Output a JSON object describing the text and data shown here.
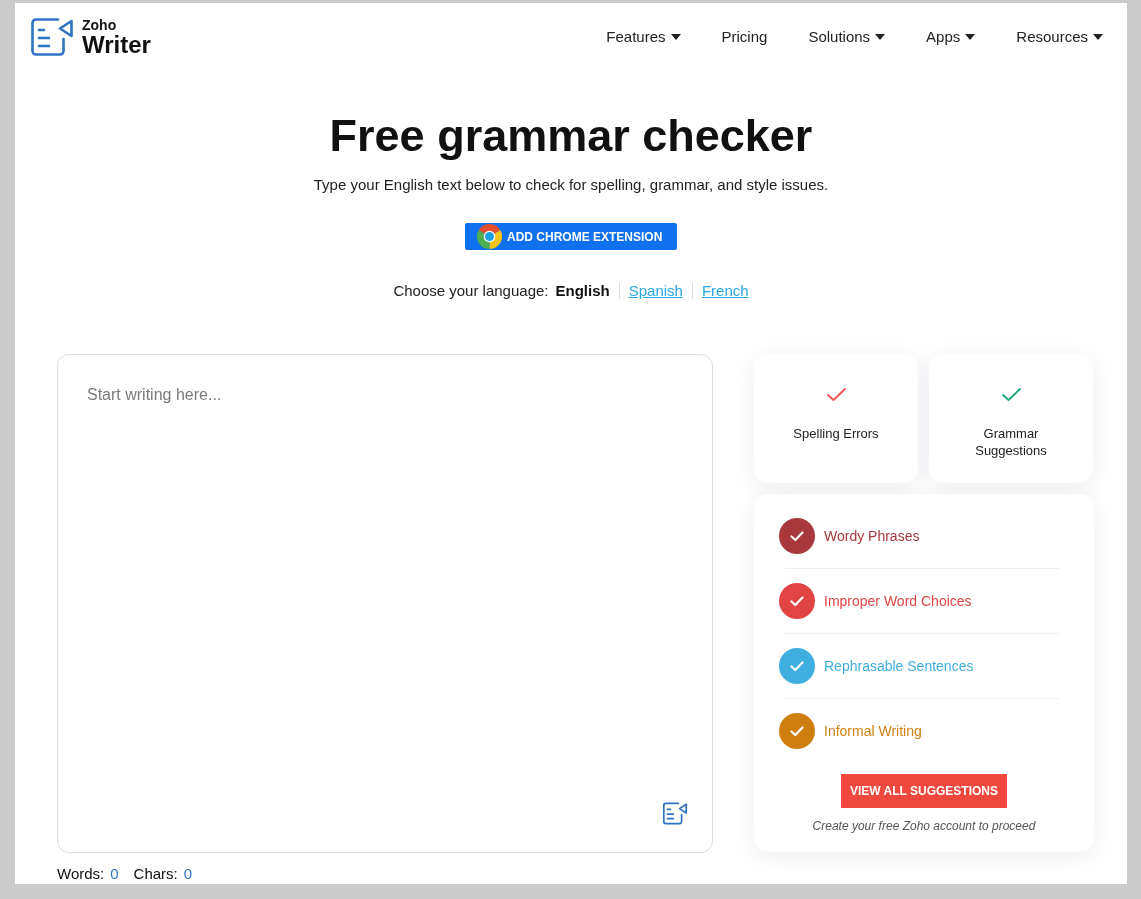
{
  "header": {
    "logo": {
      "brand": "Zoho",
      "product": "Writer"
    },
    "nav": [
      {
        "label": "Features",
        "has_menu": true
      },
      {
        "label": "Pricing",
        "has_menu": false
      },
      {
        "label": "Solutions",
        "has_menu": true
      },
      {
        "label": "Apps",
        "has_menu": true
      },
      {
        "label": "Resources",
        "has_menu": true
      }
    ]
  },
  "hero": {
    "title": "Free grammar checker",
    "subtitle": "Type your English text below to check for spelling, grammar, and style issues.",
    "button": "ADD CHROME EXTENSION"
  },
  "language": {
    "label": "Choose your language:",
    "options": [
      {
        "label": "English",
        "selected": true
      },
      {
        "label": "Spanish",
        "selected": false
      },
      {
        "label": "French",
        "selected": false
      }
    ]
  },
  "editor": {
    "placeholder": "Start writing here..."
  },
  "summary_cards": [
    {
      "label": "Spelling Errors",
      "color": "#f0524f"
    },
    {
      "label": "Grammar Suggestions",
      "color": "#1aa37a"
    }
  ],
  "categories": [
    {
      "label": "Wordy Phrases",
      "color": "#a8383b"
    },
    {
      "label": "Improper Word Choices",
      "color": "#e24444"
    },
    {
      "label": "Rephrasable Sentences",
      "color": "#3eaedf"
    },
    {
      "label": "Informal Writing",
      "color": "#cf7f10"
    }
  ],
  "suggestions_button": "VIEW ALL SUGGESTIONS",
  "signup_note": "Create your free Zoho account to proceed",
  "counters": [
    {
      "label": "Words:",
      "value": "0"
    },
    {
      "label": "Chars:",
      "value": "0"
    }
  ]
}
